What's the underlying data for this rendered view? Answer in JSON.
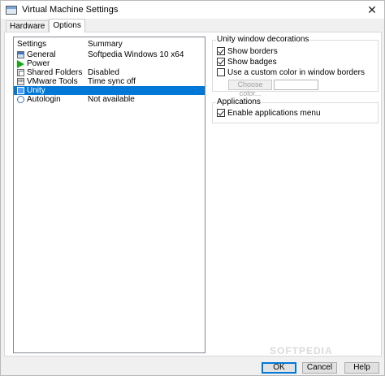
{
  "window": {
    "title": "Virtual Machine Settings",
    "close_glyph": "✕"
  },
  "tabs": [
    {
      "label": "Hardware"
    },
    {
      "label": "Options"
    }
  ],
  "settings_list": {
    "headers": {
      "settings": "Settings",
      "summary": "Summary"
    },
    "items": [
      {
        "name": "General",
        "summary": "Softpedia Windows 10 x64",
        "icon": "general-icon"
      },
      {
        "name": "Power",
        "summary": "",
        "icon": "power-icon"
      },
      {
        "name": "Shared Folders",
        "summary": "Disabled",
        "icon": "shared-folders-icon"
      },
      {
        "name": "VMware Tools",
        "summary": "Time sync off",
        "icon": "vmware-tools-icon",
        "icon_text": "vmw"
      },
      {
        "name": "Unity",
        "summary": "",
        "icon": "unity-icon",
        "selected": true
      },
      {
        "name": "Autologin",
        "summary": "Not available",
        "icon": "autologin-icon"
      }
    ]
  },
  "unity_decorations": {
    "title": "Unity window decorations",
    "show_borders": {
      "label": "Show borders",
      "checked": true
    },
    "show_badges": {
      "label": "Show badges",
      "checked": true
    },
    "custom_color": {
      "label": "Use a custom color in window borders",
      "checked": false
    },
    "choose_color_label": "Choose color..."
  },
  "applications": {
    "title": "Applications",
    "enable_menu": {
      "label": "Enable applications menu",
      "checked": true
    }
  },
  "footer": {
    "ok": "OK",
    "cancel": "Cancel",
    "help": "Help"
  },
  "watermark": "SOFTPEDIA",
  "colors": {
    "selection": "#0078d7",
    "power_green": "#17a81a"
  }
}
